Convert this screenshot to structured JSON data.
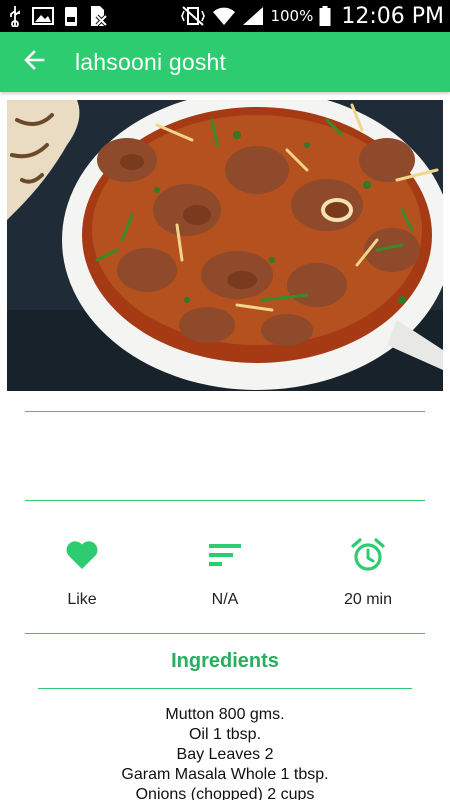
{
  "status_bar": {
    "battery_percent": "100%",
    "time": "12:06 PM",
    "colors": {
      "background": "#000000",
      "text": "#ffffff"
    },
    "icons": [
      "usb-icon",
      "image-icon",
      "storage-icon",
      "sim-off-icon",
      "vibrate-mute-icon",
      "wifi-icon",
      "signal-icon",
      "battery-icon"
    ]
  },
  "app_bar": {
    "title": "lahsooni gosht",
    "back_icon": "arrow-left-icon",
    "color": "#2ecc71"
  },
  "hero": {
    "icon": "dish-photo"
  },
  "actions": [
    {
      "label": "Like",
      "icon": "heart-icon"
    },
    {
      "label": "N/A",
      "icon": "sort-lines-icon"
    },
    {
      "label": "20 min",
      "icon": "alarm-clock-icon"
    }
  ],
  "ingredients": {
    "heading": "Ingredients",
    "items": [
      "Mutton 800 gms.",
      "Oil 1 tbsp.",
      "Bay Leaves 2",
      "Garam Masala Whole 1 tbsp.",
      "Onions (chopped) 2 cups"
    ]
  },
  "accent_color": "#2ecc71",
  "heading_color": "#27ae60"
}
